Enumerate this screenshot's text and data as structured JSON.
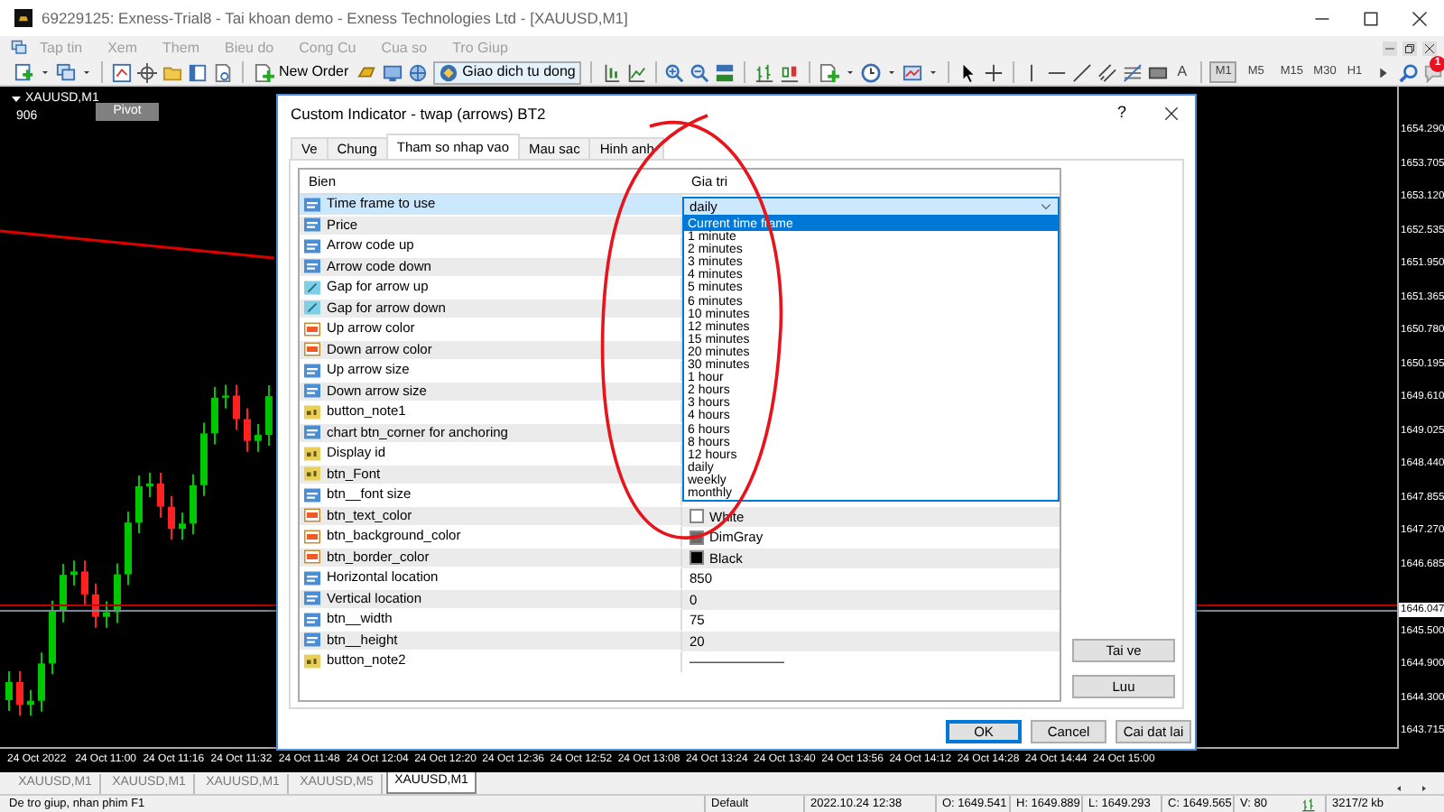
{
  "window": {
    "title": "69229125: Exness-Trial8 - Tai khoan demo - Exness Technologies Ltd - [XAUUSD,M1]"
  },
  "menu": [
    "Tap tin",
    "Xem",
    "Them",
    "Bieu do",
    "Cong Cu",
    "Cua so",
    "Tro Giup"
  ],
  "toolbar": {
    "new_order": "New Order",
    "auto_trading": "Giao dich tu dong",
    "text_tool": "A",
    "timeframes": [
      {
        "label": "M1",
        "selected": true
      },
      {
        "label": "M5",
        "selected": false
      },
      {
        "label": "M15",
        "selected": false
      },
      {
        "label": "M30",
        "selected": false
      },
      {
        "label": "H1",
        "selected": false
      }
    ],
    "notifications": "1"
  },
  "chart": {
    "symbol": "XAUUSD,M1",
    "value": "906",
    "pivot_button": "Pivot",
    "price_labels": [
      "1654.290",
      "1653.705",
      "1653.120",
      "1652.535",
      "1651.950",
      "1651.365",
      "1650.780",
      "1650.195",
      "1649.610",
      "1649.025",
      "1648.440",
      "1647.855",
      "1647.270",
      "1646.685",
      "1645.500",
      "1644.900",
      "1644.300",
      "1643.715"
    ],
    "current_price": "1646.047",
    "time_labels": [
      "24 Oct 2022",
      "24 Oct 11:00",
      "24 Oct 11:16",
      "24 Oct 11:32",
      "24 Oct 11:48",
      "24 Oct 12:04",
      "24 Oct 12:20",
      "24 Oct 12:36",
      "24 Oct 12:52",
      "24 Oct 13:08",
      "24 Oct 13:24",
      "24 Oct 13:40",
      "24 Oct 13:56",
      "24 Oct 14:12",
      "24 Oct 14:28",
      "24 Oct 14:44",
      "24 Oct 15:00"
    ]
  },
  "chart_tabs": [
    {
      "label": "XAUUSD,M1",
      "selected": false
    },
    {
      "label": "XAUUSD,M1",
      "selected": false
    },
    {
      "label": "XAUUSD,M1",
      "selected": false
    },
    {
      "label": "XAUUSD,M5",
      "selected": false
    },
    {
      "label": "XAUUSD,M1",
      "selected": true
    }
  ],
  "status_bar": [
    "De tro giup, nhan phim F1",
    "Default",
    "2022.10.24 12:38",
    "O: 1649.541",
    "H: 1649.889",
    "L: 1649.293",
    "C: 1649.565",
    "V: 80",
    "3217/2 kb"
  ],
  "dialog": {
    "title": "Custom Indicator - twap (arrows) BT2",
    "help": "?",
    "tabs": [
      {
        "label": "Ve",
        "selected": false
      },
      {
        "label": "Chung",
        "selected": false
      },
      {
        "label": "Tham so nhap vao",
        "selected": true
      },
      {
        "label": "Mau sac",
        "selected": false
      },
      {
        "label": "Hinh anh",
        "selected": false
      }
    ],
    "columns": [
      "Bien",
      "Gia tri"
    ],
    "rows": [
      {
        "name": "Time frame to use",
        "kind": "int",
        "selected": true
      },
      {
        "name": "Price",
        "kind": "int",
        "selected": false
      },
      {
        "name": "Arrow code up",
        "kind": "int",
        "selected": false
      },
      {
        "name": "Arrow code down",
        "kind": "int",
        "selected": false
      },
      {
        "name": "Gap for arrow up",
        "kind": "double",
        "selected": false
      },
      {
        "name": "Gap for arrow down",
        "kind": "double",
        "selected": false
      },
      {
        "name": "Up arrow color",
        "kind": "color",
        "selected": false
      },
      {
        "name": "Down arrow color",
        "kind": "color",
        "selected": false
      },
      {
        "name": "Up arrow size",
        "kind": "int",
        "selected": false
      },
      {
        "name": "Down arrow size",
        "kind": "int",
        "selected": false
      },
      {
        "name": "button_note1",
        "kind": "string",
        "selected": false
      },
      {
        "name": "chart btn_corner for anchoring",
        "kind": "int",
        "selected": false
      },
      {
        "name": "Display id",
        "kind": "string",
        "selected": false
      },
      {
        "name": "btn_Font",
        "kind": "string",
        "selected": false
      },
      {
        "name": "btn__font size",
        "kind": "int",
        "selected": false
      },
      {
        "name": "btn_text_color",
        "kind": "color",
        "selected": false,
        "value": "White",
        "color": "#ffffff"
      },
      {
        "name": "btn_background_color",
        "kind": "color",
        "selected": false,
        "value": "DimGray",
        "color": "#696969"
      },
      {
        "name": "btn_border_color",
        "kind": "color",
        "selected": false,
        "value": "Black",
        "color": "#000000"
      },
      {
        "name": "Horizontal location",
        "kind": "int",
        "selected": false,
        "value": "850"
      },
      {
        "name": "Vertical location",
        "kind": "int",
        "selected": false,
        "value": "0"
      },
      {
        "name": "btn__width",
        "kind": "int",
        "selected": false,
        "value": "75"
      },
      {
        "name": "btn__height",
        "kind": "int",
        "selected": false,
        "value": "20"
      },
      {
        "name": "button_note2",
        "kind": "string",
        "selected": false,
        "value": "———————"
      }
    ],
    "dropdown": {
      "value": "daily",
      "options": [
        {
          "label": "Current time frame",
          "highlighted": true
        },
        {
          "label": "1 minute",
          "highlighted": false
        },
        {
          "label": "2 minutes",
          "highlighted": false
        },
        {
          "label": "3 minutes",
          "highlighted": false
        },
        {
          "label": "4 minutes",
          "highlighted": false
        },
        {
          "label": "5 minutes",
          "highlighted": false
        },
        {
          "label": "6 minutes",
          "highlighted": false
        },
        {
          "label": "10 minutes",
          "highlighted": false
        },
        {
          "label": "12 minutes",
          "highlighted": false
        },
        {
          "label": "15 minutes",
          "highlighted": false
        },
        {
          "label": "20 minutes",
          "highlighted": false
        },
        {
          "label": "30 minutes",
          "highlighted": false
        },
        {
          "label": "1 hour",
          "highlighted": false
        },
        {
          "label": "2 hours",
          "highlighted": false
        },
        {
          "label": "3 hours",
          "highlighted": false
        },
        {
          "label": "4 hours",
          "highlighted": false
        },
        {
          "label": "6 hours",
          "highlighted": false
        },
        {
          "label": "8 hours",
          "highlighted": false
        },
        {
          "label": "12 hours",
          "highlighted": false
        },
        {
          "label": "daily",
          "highlighted": false
        },
        {
          "label": "weekly",
          "highlighted": false
        },
        {
          "label": "monthly",
          "highlighted": false
        }
      ]
    },
    "side_buttons": [
      "Tai ve",
      "Luu"
    ],
    "buttons": [
      {
        "label": "OK",
        "default": true
      },
      {
        "label": "Cancel",
        "default": false
      },
      {
        "label": "Cai dat lai",
        "default": false
      }
    ]
  }
}
